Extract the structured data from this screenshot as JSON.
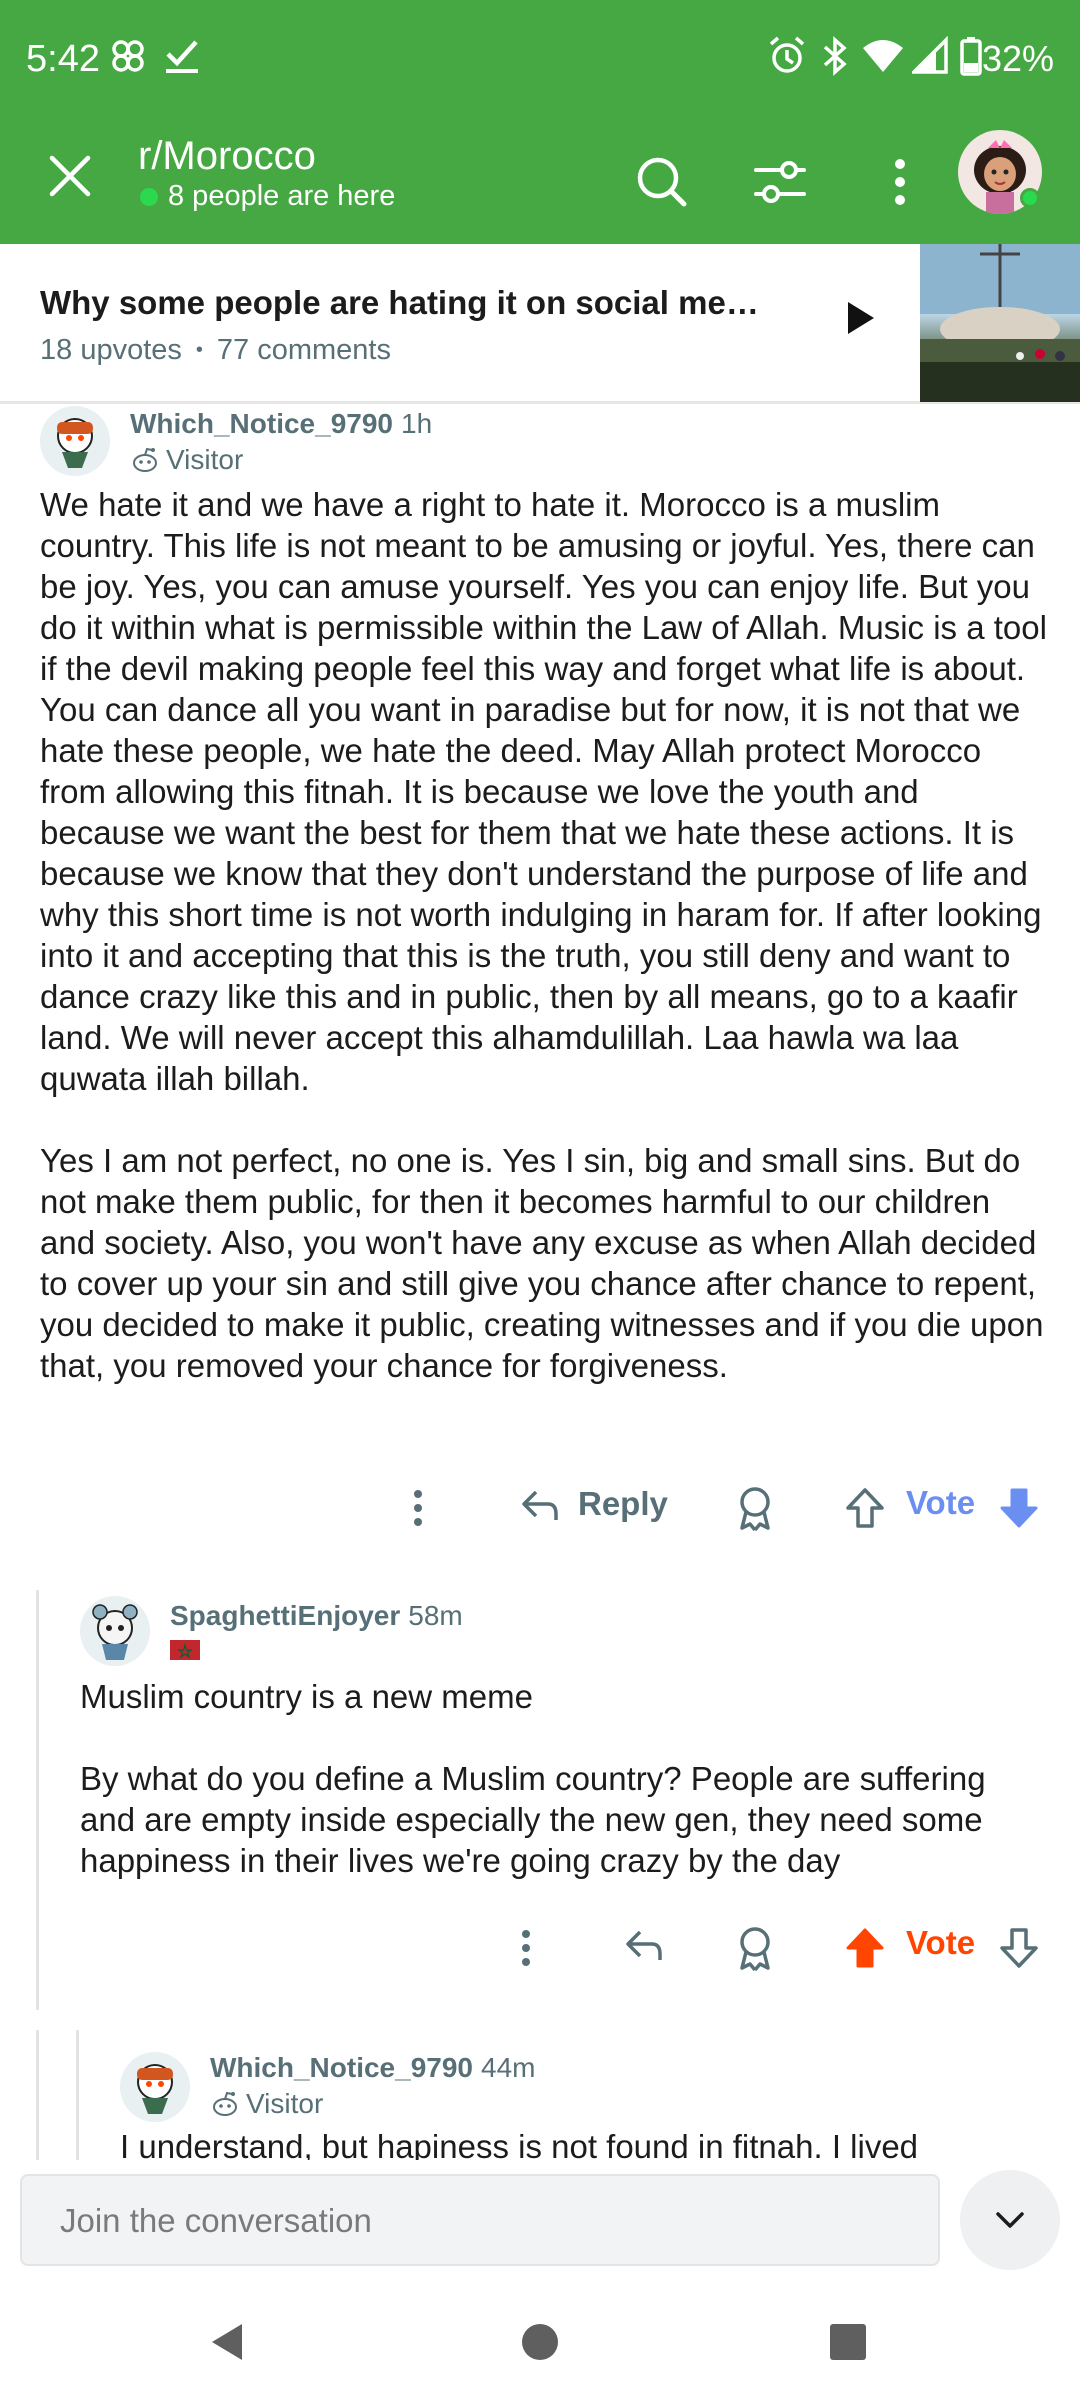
{
  "status_bar": {
    "time": "5:42",
    "battery": "32%",
    "icons": [
      "pinwheel-icon",
      "check-icon",
      "alarm-icon",
      "bluetooth-icon",
      "wifi-icon",
      "signal-icon",
      "battery-icon"
    ]
  },
  "header": {
    "subreddit": "r/Morocco",
    "presence": "8 people are here",
    "icons": [
      "close-icon",
      "search-icon",
      "filter-icon",
      "more-vertical-icon",
      "user-avatar"
    ]
  },
  "post": {
    "title": "Why some people are hating it on social me…",
    "upvotes": "18 upvotes",
    "separator": "•",
    "comments": "77 comments"
  },
  "comments": [
    {
      "author": "Which_Notice_9790",
      "age": "1h",
      "flair": "Visitor",
      "paragraphs": [
        "We hate it and we have a right to hate it. Morocco is a muslim country. This life is not meant to be amusing or joyful. Yes, there can be joy. Yes, you can amuse yourself. Yes you can enjoy life. But you do it within what is permissible within the Law of Allah. Music is a tool if the devil making people feel this way and forget what life is about. You can dance all you want in paradise but for now, it is not that we hate these people, we hate the deed. May Allah protect Morocco from allowing this fitnah. It is because we love the youth and because we want the best for them that we hate these actions. It is because we know that they don't understand the purpose of life and why this short time is not worth indulging in haram for. If after looking into it and accepting that this is the truth, you still deny and want to dance crazy like this and in public, then by all means, go to a kaafir land. We will never accept this alhamdulillah. Laa hawla wa laa quwata illah billah.",
        "Yes I am not perfect, no one is. Yes I sin, big and small sins. But do not make them public, for then it becomes harmful to our children and society. Also, you won't have any excuse as when Allah decided to cover up your sin and still give you chance after chance to repent, you decided to make it public, creating witnesses and if you die upon that, you removed your chance for forgiveness."
      ],
      "reply_label": "Reply",
      "vote_label": "Vote",
      "vote_state": "downvoted"
    },
    {
      "author": "SpaghettiEnjoyer",
      "age": "58m",
      "flair": "Morocco flag",
      "paragraphs": [
        "Muslim country is a new meme",
        "By what do you define a Muslim country? People are suffering and are empty inside especially the new gen, they need some happiness in their lives we're going crazy by the day"
      ],
      "vote_label": "Vote",
      "vote_state": "upvoted"
    },
    {
      "author": "Which_Notice_9790",
      "age": "44m",
      "flair": "Visitor",
      "paragraphs": [
        "I understand, but hapiness is not found in fitnah. I lived"
      ]
    }
  ],
  "composer": {
    "placeholder": "Join the conversation"
  },
  "colors": {
    "brand_green": "#46a843",
    "vote_blue": "#6b8ff0",
    "upvote_orange": "#ff4500",
    "meta_gray": "#576f76"
  }
}
